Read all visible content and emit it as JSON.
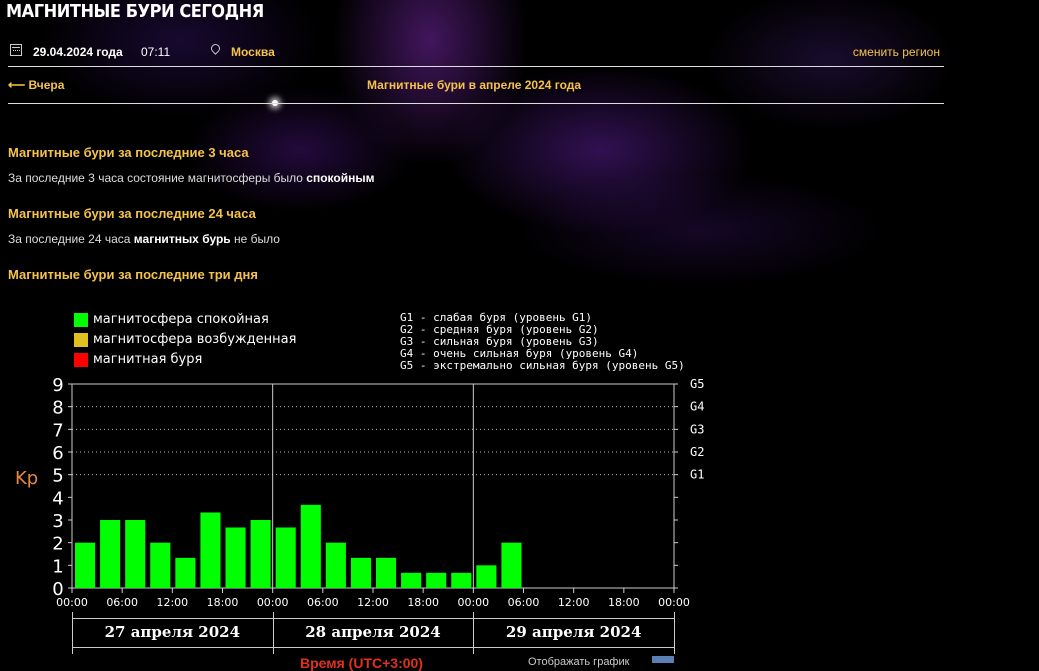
{
  "site": {
    "title": "МАГНИТНЫЕ БУРИ СЕГОДНЯ"
  },
  "topbar": {
    "date": "29.04.2024 года",
    "time": "07:11",
    "city": "Москва",
    "change_region": "сменить регион",
    "icons": [
      "calendar-icon",
      "location-pin-icon"
    ]
  },
  "nav": {
    "prev": "⟵ Вчера",
    "month": "Магнитные бури в апреле 2024 года"
  },
  "sections": {
    "last3": {
      "heading": "Магнитные бури за последние 3 часа",
      "text_before": "За последние 3 часа состояние магнитосферы было ",
      "text_bold": "спокойным"
    },
    "last24": {
      "heading": "Магнитные бури за последние 24 часа",
      "text_before": "За последние 24 часа ",
      "text_bold": "магнитных бурь",
      "text_after": " не было"
    },
    "last3days": {
      "heading": "Магнитные бури за последние три дня"
    }
  },
  "legend": [
    {
      "label": "магнитосфера спокойная",
      "color": "#00ff00"
    },
    {
      "label": "магнитосфера возбужденная",
      "color": "#e0c020"
    },
    {
      "label": "магнитная буря",
      "color": "#ff0000"
    }
  ],
  "storm_levels": [
    "G1 - слабая буря (уровень G1)",
    "G2 - средняя буря (уровень G2)",
    "G3 - сильная буря (уровень G3)",
    "G4 - очень сильная буря (уровень G4)",
    "G5 - экстремально сильная буря (уровень G5)"
  ],
  "chart_data": {
    "type": "bar",
    "ylabel": "Kp",
    "ylim": [
      0,
      9
    ],
    "yticks": [
      "0",
      "1",
      "2",
      "3",
      "4",
      "5",
      "6",
      "7",
      "8",
      "9"
    ],
    "right_labels": [
      {
        "label": "G1",
        "y": 5
      },
      {
        "label": "G2",
        "y": 6
      },
      {
        "label": "G3",
        "y": 7
      },
      {
        "label": "G4",
        "y": 8
      },
      {
        "label": "G5",
        "y": 9
      }
    ],
    "xticks": [
      "00:00",
      "06:00",
      "12:00",
      "18:00",
      "00:00",
      "06:00",
      "12:00",
      "18:00",
      "00:00",
      "06:00",
      "12:00",
      "18:00",
      "00:00"
    ],
    "days": [
      "27 апреля 2024",
      "28 апреля 2024",
      "29 апреля 2024"
    ],
    "bar_color": "#00ff00",
    "grid_dotted_levels": [
      5,
      6,
      7,
      8,
      9
    ],
    "values": [
      2.0,
      3.0,
      3.0,
      2.0,
      1.33,
      3.33,
      2.67,
      3.0,
      2.67,
      3.67,
      2.0,
      1.33,
      1.33,
      0.67,
      0.67,
      0.67,
      1.0,
      2.0
    ]
  },
  "bottom": {
    "left_text": "Время (UTC+3:00)",
    "right_text": "Отображать график"
  }
}
